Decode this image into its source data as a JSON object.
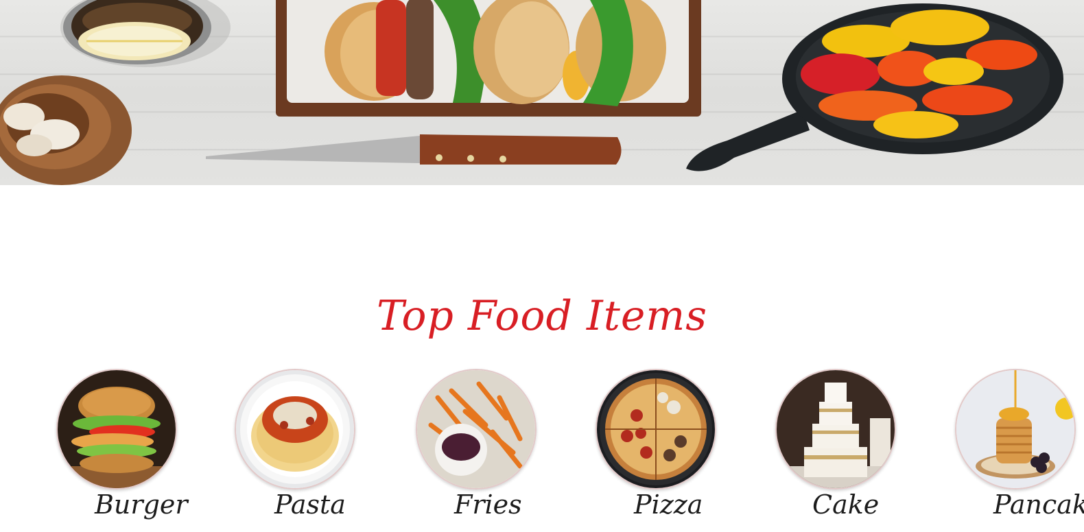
{
  "hero": {
    "icon": "food-table-banner",
    "colors": {
      "wood": "#e0e0de",
      "board": "#6b3a21",
      "pan": "#1f2326",
      "accent_red": "#d81e24"
    }
  },
  "section": {
    "title": "Top Food Items"
  },
  "food_items": [
    {
      "label": "Burger",
      "icon": "burger-icon"
    },
    {
      "label": "Pasta",
      "icon": "pasta-icon"
    },
    {
      "label": "Fries",
      "icon": "fries-icon"
    },
    {
      "label": "Pizza",
      "icon": "pizza-icon"
    },
    {
      "label": "Cake",
      "icon": "cake-icon"
    },
    {
      "label": "Pancake",
      "icon": "pancake-icon"
    }
  ]
}
